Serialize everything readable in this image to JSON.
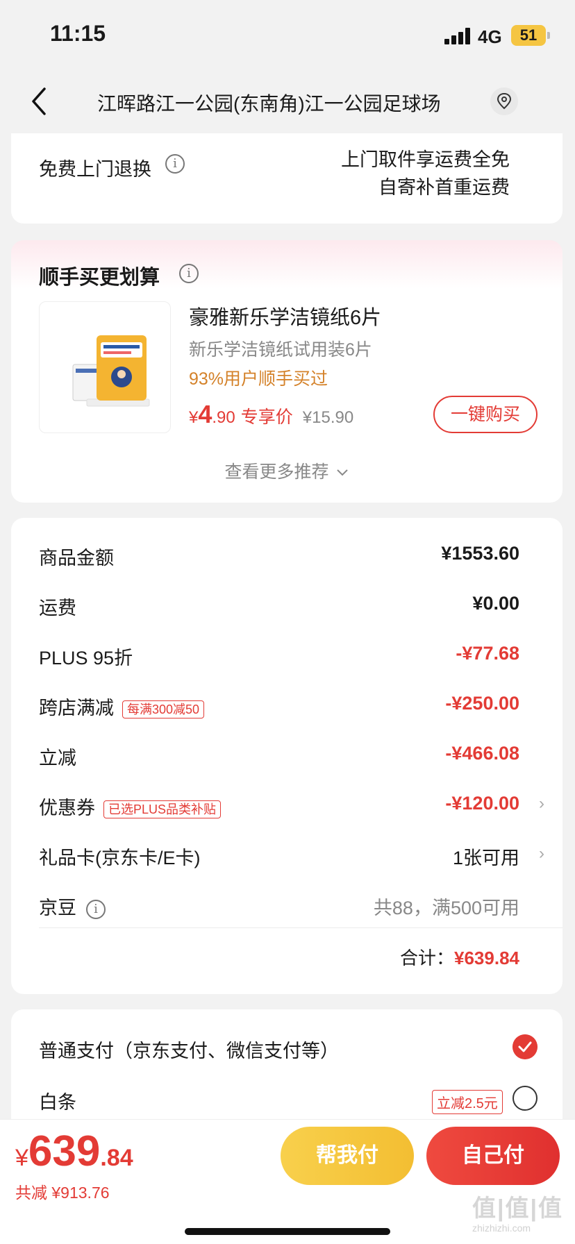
{
  "status_bar": {
    "time": "11:15",
    "network": "4G",
    "battery": "51"
  },
  "header": {
    "title": "江晖路江一公园(东南角)江一公园足球场"
  },
  "return_service": {
    "label": "免费上门退换",
    "line1": "上门取件享运费全免",
    "line2": "自寄补首重运费"
  },
  "recommend": {
    "title": "顺手买更划算",
    "product": {
      "name": "豪雅新乐学洁镜纸6片",
      "subtitle": "新乐学洁镜纸试用装6片",
      "bought": "93%用户顺手买过",
      "price_symbol": "¥",
      "price_int": "4",
      "price_dec": ".90",
      "price_tag": "专享价",
      "original_price": "¥15.90",
      "buy_label": "一键购买"
    },
    "more_label": "查看更多推荐"
  },
  "summary": {
    "rows": [
      {
        "label": "商品金额",
        "value": "¥1553.60"
      },
      {
        "label": "运费",
        "value": "¥0.00"
      },
      {
        "label": "PLUS 95折",
        "value": "-¥77.68"
      },
      {
        "label": "跨店满减",
        "badge": "每满300减50",
        "value": "-¥250.00"
      },
      {
        "label": "立减",
        "value": "-¥466.08"
      },
      {
        "label": "优惠券",
        "badge": "已选PLUS品类补贴",
        "value": "-¥120.00"
      },
      {
        "label": "礼品卡(京东卡/E卡)",
        "value": "1张可用"
      },
      {
        "label": "京豆",
        "value": "共88，满500可用"
      }
    ],
    "total_label": "合计：",
    "total_value": "¥639.84"
  },
  "payment": {
    "options": [
      {
        "label": "普通支付（京东支付、微信支付等）",
        "selected": true
      },
      {
        "label": "白条",
        "badge": "立减2.5元",
        "selected": false
      }
    ]
  },
  "bottom_bar": {
    "price_symbol": "¥",
    "price_int": "639",
    "price_dec": ".84",
    "saved": "共减 ¥913.76",
    "help_pay": "帮我付",
    "self_pay": "自己付",
    "watermark": "值|值|值",
    "watermark_sub": "zhizhizhi.com"
  },
  "colors": {
    "accent_red": "#e33b35",
    "yellow": "#f5c542",
    "bought_orange": "#d4822a"
  }
}
